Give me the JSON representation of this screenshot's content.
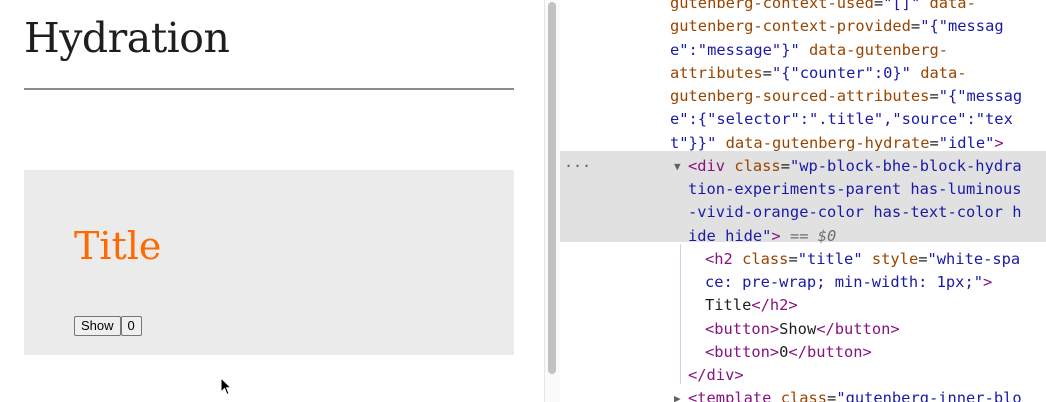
{
  "page": {
    "title": "Hydration",
    "block": {
      "title": "Title",
      "show_button": "Show",
      "counter_button": "0"
    },
    "title_color": "#ff6900",
    "block_background": "#ebebeb"
  },
  "devtools": {
    "lines": [
      {
        "segs": [
          [
            "a",
            "gutenberg-context-used"
          ],
          [
            "p",
            "="
          ],
          [
            "v",
            "\"[]\""
          ],
          [
            "p",
            " "
          ],
          [
            "a",
            "data-"
          ]
        ]
      },
      {
        "segs": [
          [
            "a",
            "gutenberg-context-provided"
          ],
          [
            "p",
            "="
          ],
          [
            "v",
            "\"{\"messag"
          ]
        ]
      },
      {
        "segs": [
          [
            "v",
            "e\":\"message\"}\""
          ],
          [
            "p",
            " "
          ],
          [
            "a",
            "data-gutenberg-"
          ]
        ]
      },
      {
        "segs": [
          [
            "a",
            "attributes"
          ],
          [
            "p",
            "="
          ],
          [
            "v",
            "\"{\"counter\":0}\""
          ],
          [
            "p",
            " "
          ],
          [
            "a",
            "data-"
          ]
        ]
      },
      {
        "segs": [
          [
            "a",
            "gutenberg-sourced-attributes"
          ],
          [
            "p",
            "="
          ],
          [
            "v",
            "\"{\"messag"
          ]
        ]
      },
      {
        "segs": [
          [
            "v",
            "e\":{\"selector\":\".title\",\"source\":\"tex"
          ]
        ]
      },
      {
        "segs": [
          [
            "v",
            "t\"}}\""
          ],
          [
            "p",
            " "
          ],
          [
            "a",
            "data-gutenberg-hydrate"
          ],
          [
            "p",
            "="
          ],
          [
            "v",
            "\"idle\""
          ],
          [
            "t",
            ">"
          ]
        ]
      },
      {
        "segs": [
          [
            "t",
            "<div"
          ],
          [
            "p",
            " "
          ],
          [
            "a",
            "class"
          ],
          [
            "p",
            "="
          ],
          [
            "v",
            "\"wp-block-bhe-block-hydra"
          ]
        ]
      },
      {
        "segs": [
          [
            "v",
            "tion-experiments-parent has-luminous"
          ]
        ]
      },
      {
        "segs": [
          [
            "v",
            "-vivid-orange-color has-text-color h"
          ]
        ]
      },
      {
        "segs": [
          [
            "v",
            "ide hide\""
          ],
          [
            "t",
            ">"
          ],
          [
            "p",
            " "
          ],
          [
            "ref",
            "== $0"
          ]
        ]
      },
      {
        "segs": [
          [
            "t",
            "<h2"
          ],
          [
            "p",
            " "
          ],
          [
            "a",
            "class"
          ],
          [
            "p",
            "="
          ],
          [
            "v",
            "\"title\""
          ],
          [
            "p",
            " "
          ],
          [
            "a",
            "style"
          ],
          [
            "p",
            "="
          ],
          [
            "v",
            "\"white-spa"
          ]
        ]
      },
      {
        "segs": [
          [
            "v",
            "ce: pre-wrap; min-width: 1px;\""
          ],
          [
            "t",
            ">"
          ]
        ]
      },
      {
        "segs": [
          [
            "p",
            "Title"
          ],
          [
            "t",
            "</h2>"
          ]
        ]
      },
      {
        "segs": [
          [
            "t",
            "<button>"
          ],
          [
            "p",
            "Show"
          ],
          [
            "t",
            "</button>"
          ]
        ]
      },
      {
        "segs": [
          [
            "t",
            "<button>"
          ],
          [
            "p",
            "0"
          ],
          [
            "t",
            "</button>"
          ]
        ]
      },
      {
        "segs": [
          [
            "t",
            "</div>"
          ]
        ]
      },
      {
        "segs": [
          [
            "t",
            "<template"
          ],
          [
            "p",
            " "
          ],
          [
            "a",
            "class"
          ],
          [
            "p",
            "="
          ],
          [
            "v",
            "\"gutenberg-inner-blo"
          ]
        ]
      }
    ],
    "selected_marker": "...",
    "expand_icon": "triangle-down",
    "collapse_icon": "triangle-right"
  }
}
